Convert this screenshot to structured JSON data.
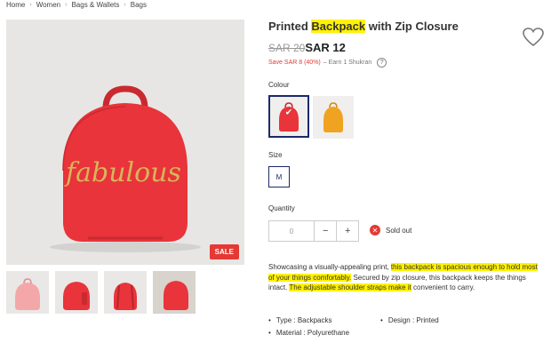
{
  "breadcrumb": [
    "Home",
    "Women",
    "Bags & Wallets",
    "Bags"
  ],
  "product": {
    "title_before": "Printed ",
    "title_highlight": "Backpack",
    "title_after": " with Zip Closure",
    "old_price": "SAR 20",
    "new_price": "SAR 12",
    "save_text": "Save SAR 8 (40%)",
    "earn_text": "– Earn 1 Shukran",
    "help_symbol": "?",
    "sale_badge": "SALE",
    "bag_print": "fabulous"
  },
  "options": {
    "colour_label": "Colour",
    "colour_selected_mark": "✔",
    "size_label": "Size",
    "size_value": "M",
    "quantity_label": "Quantity",
    "quantity_value": "0",
    "minus": "−",
    "plus": "+",
    "sold_out": "Sold out",
    "sold_out_icon": "✕"
  },
  "description": {
    "p1": "Showcasing a visually-appealing print, ",
    "h1": "this backpack is spacious enough to hold most of your things comfortably.",
    "p2": " Secured by zip closure, this backpack keeps the things intact. ",
    "h2": "The adjustable shoulder straps make it",
    "p3": " convenient to carry."
  },
  "specs": [
    "Type : Backpacks",
    "Design : Printed",
    "Material : Polyurethane"
  ],
  "colors": {
    "accent": "#1b2a6b",
    "sale": "#e53935",
    "highlight": "#fff200",
    "bag_red": "#e8343a",
    "bag_yellow": "#f0a320",
    "bag_pink": "#f4a7a8"
  },
  "icons": {
    "wishlist": "heart-icon",
    "help": "question-icon",
    "sold_out": "close-circle-icon"
  }
}
